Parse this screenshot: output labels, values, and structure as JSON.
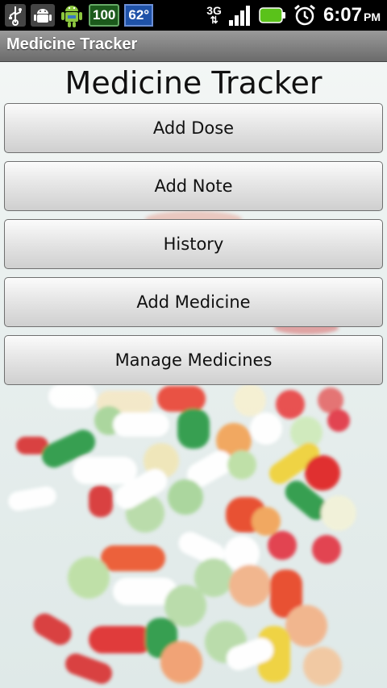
{
  "status_bar": {
    "battery_level": "100",
    "temperature": "62°",
    "network_type": "3G",
    "time": "6:07",
    "ampm": "PM",
    "icons": [
      "usb-icon",
      "android-debug-icon",
      "android-mascot-icon",
      "battery-level-icon",
      "temperature-icon",
      "network-3g-icon",
      "signal-icon",
      "battery-icon",
      "alarm-icon"
    ]
  },
  "app": {
    "title": "Medicine Tracker"
  },
  "main": {
    "heading": "Medicine Tracker",
    "buttons": [
      {
        "label": "Add Dose"
      },
      {
        "label": "Add Note"
      },
      {
        "label": "History"
      },
      {
        "label": "Add Medicine"
      },
      {
        "label": "Manage Medicines"
      }
    ]
  },
  "colors": {
    "status_bg": "#000000",
    "title_bg": "#7a7a7a",
    "battery_badge": "#1c5a1c",
    "temp_badge": "#1f52a8"
  }
}
